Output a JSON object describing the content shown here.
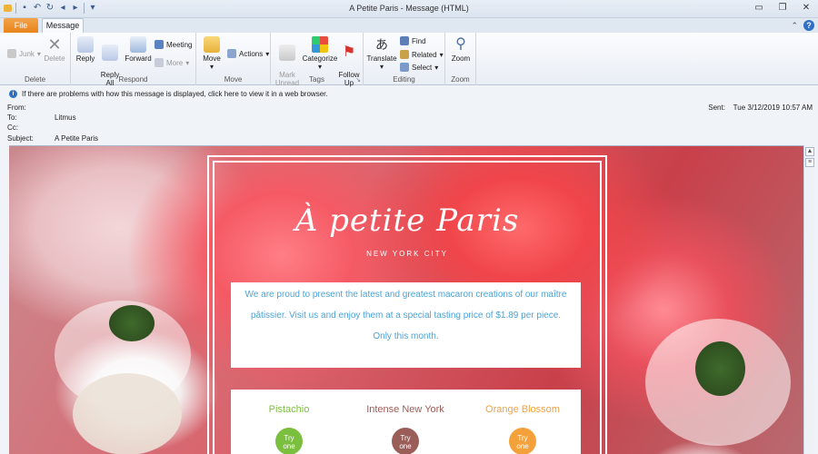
{
  "window": {
    "title": "A Petite Paris  -  Message (HTML)"
  },
  "tabs": {
    "file": "File",
    "message": "Message"
  },
  "ribbon": {
    "delete_group": {
      "label": "Delete",
      "junk": "Junk",
      "delete": "Delete"
    },
    "respond_group": {
      "label": "Respond",
      "reply": "Reply",
      "reply_all": "Reply\nAll",
      "forward": "Forward",
      "meeting": "Meeting",
      "more": "More"
    },
    "move_group": {
      "label": "Move",
      "move": "Move",
      "actions": "Actions"
    },
    "tags_group": {
      "label": "Tags",
      "mark_unread": "Mark\nUnread",
      "categorize": "Categorize",
      "follow_up": "Follow\nUp"
    },
    "editing_group": {
      "label": "Editing",
      "translate": "Translate",
      "find": "Find",
      "related": "Related",
      "select": "Select"
    },
    "zoom_group": {
      "label": "Zoom",
      "zoom": "Zoom"
    }
  },
  "infobar": {
    "text": "If there are problems with how this message is displayed, click here to view it in a web browser."
  },
  "header": {
    "from_label": "From:",
    "from_value": "",
    "to_label": "To:",
    "to_value": "Litmus",
    "cc_label": "Cc:",
    "cc_value": "",
    "subject_label": "Subject:",
    "subject_value": "A Petite Paris",
    "sent_label": "Sent:",
    "sent_value": "Tue 3/12/2019 10:57 AM"
  },
  "email": {
    "logo": "À petite Paris",
    "subtitle": "NEW YORK CITY",
    "intro": "We are proud to present the latest and greatest macaron creations of our maître pâtissier. Visit us and enjoy them at a special tasting price of $1.89 per piece. Only this month.",
    "products": [
      {
        "name": "Pistachio",
        "color": "#7bbf3e",
        "button": "Try\none"
      },
      {
        "name": "Intense New York",
        "color": "#9a5d58",
        "button": "Try\none"
      },
      {
        "name": "Orange Blossom",
        "color": "#f4a13c",
        "button": "Try\none"
      }
    ]
  },
  "colors": {
    "accent_file_tab": "#e8841b",
    "link_blue": "#4aa3d6"
  }
}
